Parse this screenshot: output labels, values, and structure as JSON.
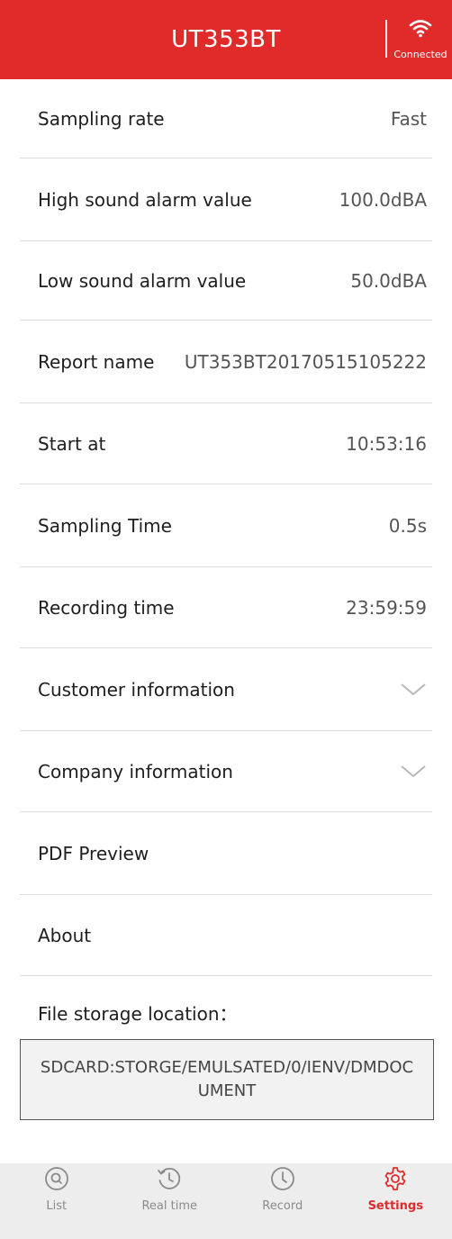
{
  "header": {
    "title": "UT353BT",
    "connection_label": "Connected",
    "connection_icon": "wifi-icon"
  },
  "settings": [
    {
      "label": "Sampling rate",
      "value": "Fast"
    },
    {
      "label": "High sound alarm value",
      "value": "100.0dBA"
    },
    {
      "label": "Low sound alarm value",
      "value": "50.0dBA"
    },
    {
      "label": "Report name",
      "value": "UT353BT20170515105222"
    },
    {
      "label": "Start at",
      "value": "10:53:16"
    },
    {
      "label": "Sampling Time",
      "value": "0.5s"
    },
    {
      "label": "Recording time",
      "value": "23:59:59"
    },
    {
      "label": "Customer information",
      "value": ""
    },
    {
      "label": "Company information",
      "value": ""
    },
    {
      "label": "PDF Preview",
      "value": ""
    },
    {
      "label": "About",
      "value": ""
    }
  ],
  "storage": {
    "label": "File storage location：",
    "path": "SDCARD:STORGE/EMULSATED/0/IENV/DMDOCUMENT"
  },
  "tabs": [
    {
      "label": "List",
      "icon": "search-circle-icon"
    },
    {
      "label": "Real time",
      "icon": "history-icon"
    },
    {
      "label": "Record",
      "icon": "clock-icon"
    },
    {
      "label": "Settings",
      "icon": "gear-icon"
    }
  ],
  "colors": {
    "accent": "#e12b2b",
    "tabbar_bg": "#ededed",
    "divider": "#dcdcdc"
  }
}
